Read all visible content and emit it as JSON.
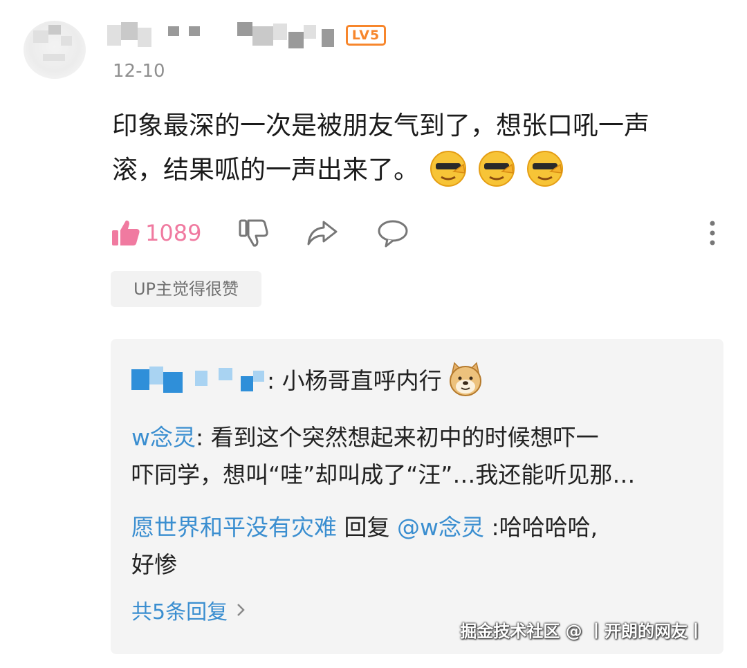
{
  "comment": {
    "level_badge": "LV5",
    "date": "12-10",
    "text_line1": "印象最深的一次是被朋友气到了，想张口吼一声",
    "text_line2": "滚，结果呱的一声出来了。",
    "emojis": [
      "sunglasses-cool-emoji",
      "sunglasses-cool-emoji",
      "sunglasses-cool-emoji"
    ],
    "like_count": "1089",
    "up_tag": "UP主觉得很赞"
  },
  "replies": {
    "reply1_text": ": 小杨哥直呼内行",
    "reply1_emoji": "doge-emoji",
    "reply2_user": "w念灵",
    "reply2_text_line1": ": 看到这个突然想起来初中的时候想吓一",
    "reply2_text_line2": "吓同学，想叫“哇”却叫成了“汪”…我还能听见那…",
    "reply3_user": "愿世界和平没有灾难",
    "reply3_verb": " 回复 ",
    "reply3_mention": "@w念灵",
    "reply3_text_line1": " :哈哈哈哈,",
    "reply3_text_line2": "好惨",
    "more_replies": "共5条回复"
  },
  "watermark": "掘金技术社区 @ 丨开朗的网友丨",
  "colors": {
    "like_pink": "#f07aa0",
    "link_blue": "#3a8ed0",
    "badge_orange": "#f7862c"
  }
}
